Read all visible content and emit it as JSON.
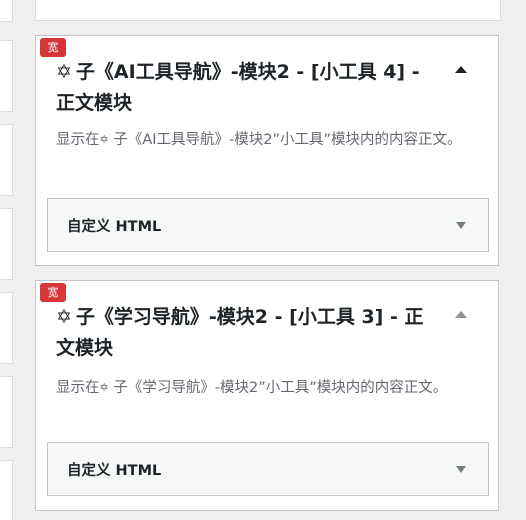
{
  "panels": [
    {
      "badge": "宽",
      "title_icon": "✡",
      "title_text": "子《AI工具导航》-模块2 - [小工具 4] - 正文模块",
      "desc_prefix": "显示在",
      "desc_icon": "✡",
      "desc_text": " 子《AI工具导航》-模块2”小工具”模块内的内容正文。",
      "field_label": "自定义 HTML"
    },
    {
      "badge": "宽",
      "title_icon": "✡",
      "title_text": "子《学习导航》-模块2 - [小工具 3] - 正文模块",
      "desc_prefix": "显示在",
      "desc_icon": "✡",
      "desc_text": " 子《学习导航》-模块2”小工具”模块内的内容正文。",
      "field_label": "自定义 HTML"
    }
  ]
}
